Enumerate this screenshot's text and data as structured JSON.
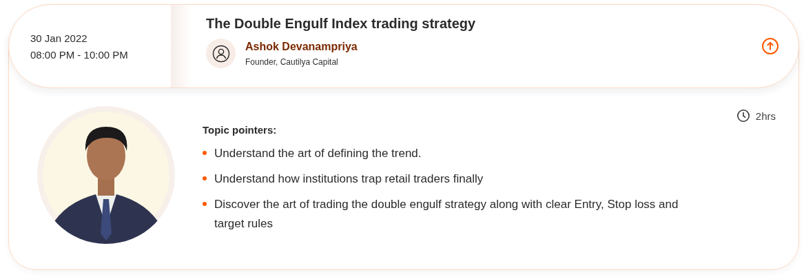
{
  "session": {
    "date": "30 Jan 2022",
    "time": "08:00 PM - 10:00 PM",
    "title": "The Double Engulf Index trading strategy",
    "speaker": {
      "name": "Ashok Devanampriya",
      "role": "Founder, Cautilya Capital"
    },
    "expanded": true
  },
  "details": {
    "duration": "2hrs",
    "heading": "Topic pointers:",
    "pointers": [
      "Understand the art of defining the trend.",
      "Understand how institutions trap retail traders finally",
      "Discover the art of trading the double engulf strategy along with clear Entry, Stop loss and target rules"
    ]
  }
}
